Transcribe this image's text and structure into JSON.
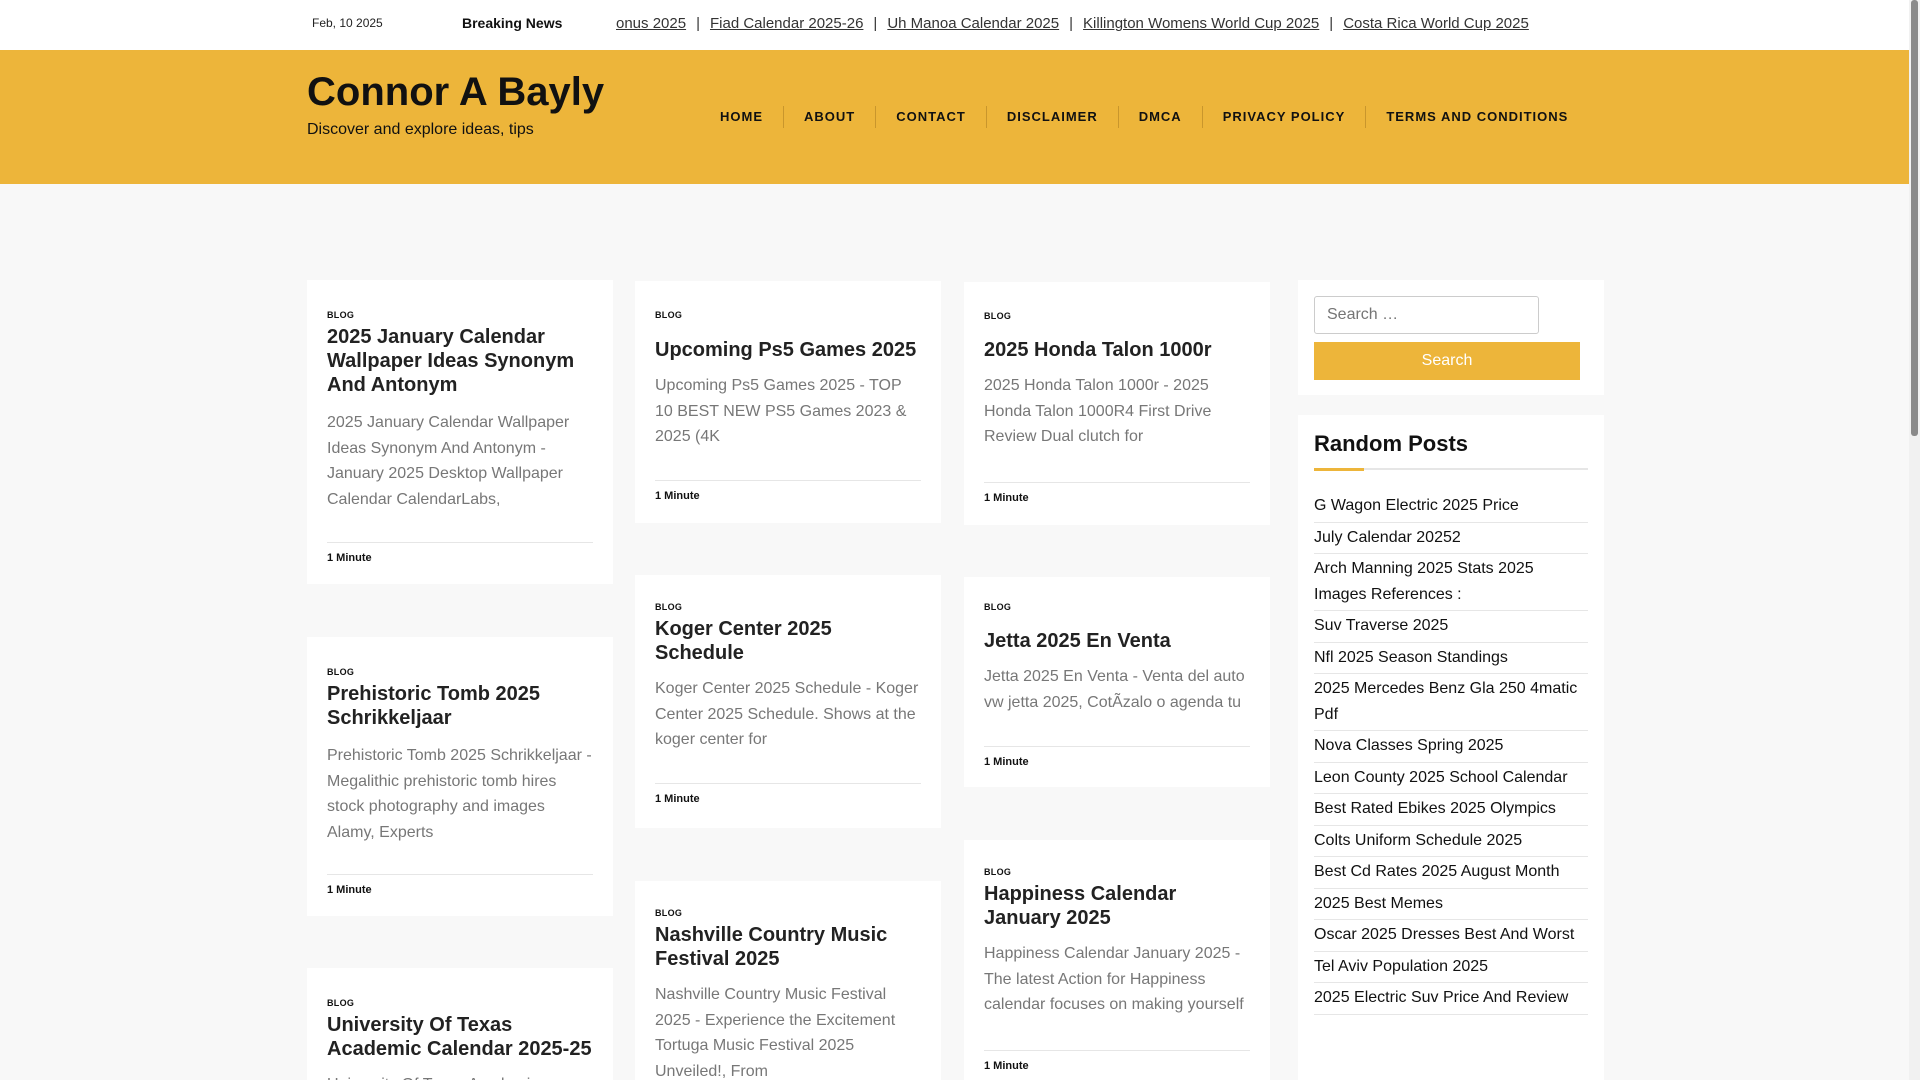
{
  "topbar": {
    "date": "Feb, 10 2025",
    "breaking_label": "Breaking News",
    "ticker": [
      "onus 2025",
      "Fiad Calendar 2025-26",
      "Uh Manoa Calendar 2025",
      "Killington Womens World Cup 2025",
      "Costa Rica World Cup 2025"
    ],
    "separator": "|"
  },
  "header": {
    "site_title": "Connor A Bayly",
    "tagline": "Discover and explore ideas, tips",
    "accent_color": "#edb53a"
  },
  "nav": {
    "items": [
      "HOME",
      "ABOUT",
      "CONTACT",
      "DISCLAIMER",
      "DMCA",
      "PRIVACY POLICY",
      "TERMS AND CONDITIONS"
    ]
  },
  "posts": [
    {
      "category": "BLOG",
      "title": "2025 January Calendar Wallpaper Ideas Synonym And Antonym",
      "excerpt": "2025 January Calendar Wallpaper Ideas Synonym And Antonym - January 2025 Desktop Wallpaper Calendar CalendarLabs,",
      "read_time": "1 Minute"
    },
    {
      "category": "BLOG",
      "title": "Upcoming Ps5 Games 2025",
      "excerpt": "Upcoming Ps5 Games 2025 - TOP 10 BEST NEW PS5 Games 2023 & 2025 (4K",
      "read_time": "1 Minute"
    },
    {
      "category": "BLOG",
      "title": "2025 Honda Talon 1000r",
      "excerpt": "2025 Honda Talon 1000r - 2025 Honda Talon 1000R4 First Drive Review Dual clutch for",
      "read_time": "1 Minute"
    },
    {
      "category": "BLOG",
      "title": "Prehistoric Tomb 2025 Schrikkeljaar",
      "excerpt": "Prehistoric Tomb 2025 Schrikkeljaar - Megalithic prehistoric tomb hires stock photography and images Alamy, Experts",
      "read_time": "1 Minute"
    },
    {
      "category": "BLOG",
      "title": "Koger Center 2025 Schedule",
      "excerpt": "Koger Center 2025 Schedule - Koger Center 2025 Schedule. Shows at the koger center for",
      "read_time": "1 Minute"
    },
    {
      "category": "BLOG",
      "title": "Jetta 2025 En Venta",
      "excerpt": "Jetta 2025 En Venta - Venta del auto vw jetta 2025, CotÃzalo o agenda tu",
      "read_time": "1 Minute"
    },
    {
      "category": "BLOG",
      "title": "University Of Texas Academic Calendar 2025-25",
      "excerpt": "University Of Texas Academic",
      "read_time": ""
    },
    {
      "category": "BLOG",
      "title": "Nashville Country Music Festival 2025",
      "excerpt": "Nashville Country Music Festival 2025 - Experience the Excitement Tortuga Music Festival 2025 Unveiled!, From",
      "read_time": ""
    },
    {
      "category": "BLOG",
      "title": "Happiness Calendar January 2025",
      "excerpt": "Happiness Calendar January 2025 - The latest Action for Happiness calendar focuses on making yourself",
      "read_time": "1 Minute"
    }
  ],
  "sidebar": {
    "search_placeholder": "Search …",
    "search_button": "Search",
    "random_title": "Random Posts",
    "random_posts": [
      "G Wagon Electric 2025 Price",
      "July Calendar 20252",
      "Arch Manning 2025 Stats 2025 Images References :",
      "Suv Traverse 2025",
      "Nfl 2025 Season Standings",
      "2025 Mercedes Benz Gla 250 4matic Pdf",
      "Nova Classes Spring 2025",
      "Leon County 2025 School Calendar",
      "Best Rated Ebikes 2025 Olympics",
      "Colts Uniform Schedule 2025",
      "Best Cd Rates 2025 August Month",
      "2025 Best Memes",
      "Oscar 2025 Dresses Best And Worst",
      "Tel Aviv Population 2025",
      "2025 Electric Suv Price And Review"
    ]
  }
}
